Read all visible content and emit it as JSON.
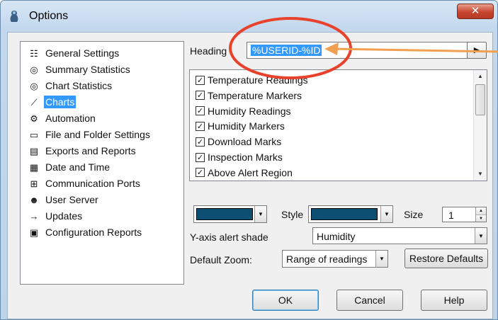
{
  "window": {
    "title": "Options",
    "close_glyph": "✕",
    "app_icon": "options-app-icon"
  },
  "nav": {
    "items": [
      {
        "label": "General Settings",
        "icon": "general-settings-icon",
        "glyph": "☷",
        "selected": false
      },
      {
        "label": "Summary Statistics",
        "icon": "summary-statistics-icon",
        "glyph": "◎",
        "selected": false
      },
      {
        "label": "Chart Statistics",
        "icon": "chart-statistics-icon",
        "glyph": "◎",
        "selected": false
      },
      {
        "label": "Charts",
        "icon": "charts-icon",
        "glyph": "⟋",
        "selected": true
      },
      {
        "label": "Automation",
        "icon": "automation-icon",
        "glyph": "⚙",
        "selected": false
      },
      {
        "label": "File and Folder Settings",
        "icon": "folder-icon",
        "glyph": "▭",
        "selected": false
      },
      {
        "label": "Exports and Reports",
        "icon": "exports-icon",
        "glyph": "▤",
        "selected": false
      },
      {
        "label": "Date and Time",
        "icon": "calendar-icon",
        "glyph": "▦",
        "selected": false
      },
      {
        "label": "Communication Ports",
        "icon": "port-icon",
        "glyph": "⊞",
        "selected": false
      },
      {
        "label": "User Server",
        "icon": "user-server-icon",
        "glyph": "☻",
        "selected": false
      },
      {
        "label": "Updates",
        "icon": "arrow-right-icon",
        "glyph": "→",
        "selected": false
      },
      {
        "label": "Configuration Reports",
        "icon": "config-report-icon",
        "glyph": "▣",
        "selected": false
      }
    ]
  },
  "heading": {
    "label": "Heading",
    "value": "%USERID-%ID",
    "button_glyph": "▶"
  },
  "checklist": {
    "items": [
      {
        "label": "Temperature Readings",
        "checked": true
      },
      {
        "label": "Temperature Markers",
        "checked": true
      },
      {
        "label": "Humidity Readings",
        "checked": true
      },
      {
        "label": "Humidity Markers",
        "checked": true
      },
      {
        "label": "Download Marks",
        "checked": true
      },
      {
        "label": "Inspection Marks",
        "checked": true
      },
      {
        "label": "Above Alert Region",
        "checked": true
      }
    ],
    "check_glyph": "✓"
  },
  "style_row": {
    "color_value": "#0d4f73",
    "style_label": "Style",
    "style_color": "#0d4f73",
    "size_label": "Size",
    "size_value": "1"
  },
  "alert_shade": {
    "label": "Y-axis alert shade",
    "value": "Humidity"
  },
  "zoom": {
    "label": "Default Zoom:",
    "value": "Range of readings",
    "restore_label": "Restore Defaults"
  },
  "buttons": {
    "ok": "OK",
    "cancel": "Cancel",
    "help": "Help"
  },
  "colors": {
    "selection": "#3399ff",
    "annotation_circle": "#e8412c",
    "annotation_arrow": "#f0a050"
  },
  "glyphs": {
    "dropdown": "▼",
    "scroll_up": "▲",
    "scroll_down": "▼",
    "spin_up": "▲",
    "spin_down": "▼"
  }
}
